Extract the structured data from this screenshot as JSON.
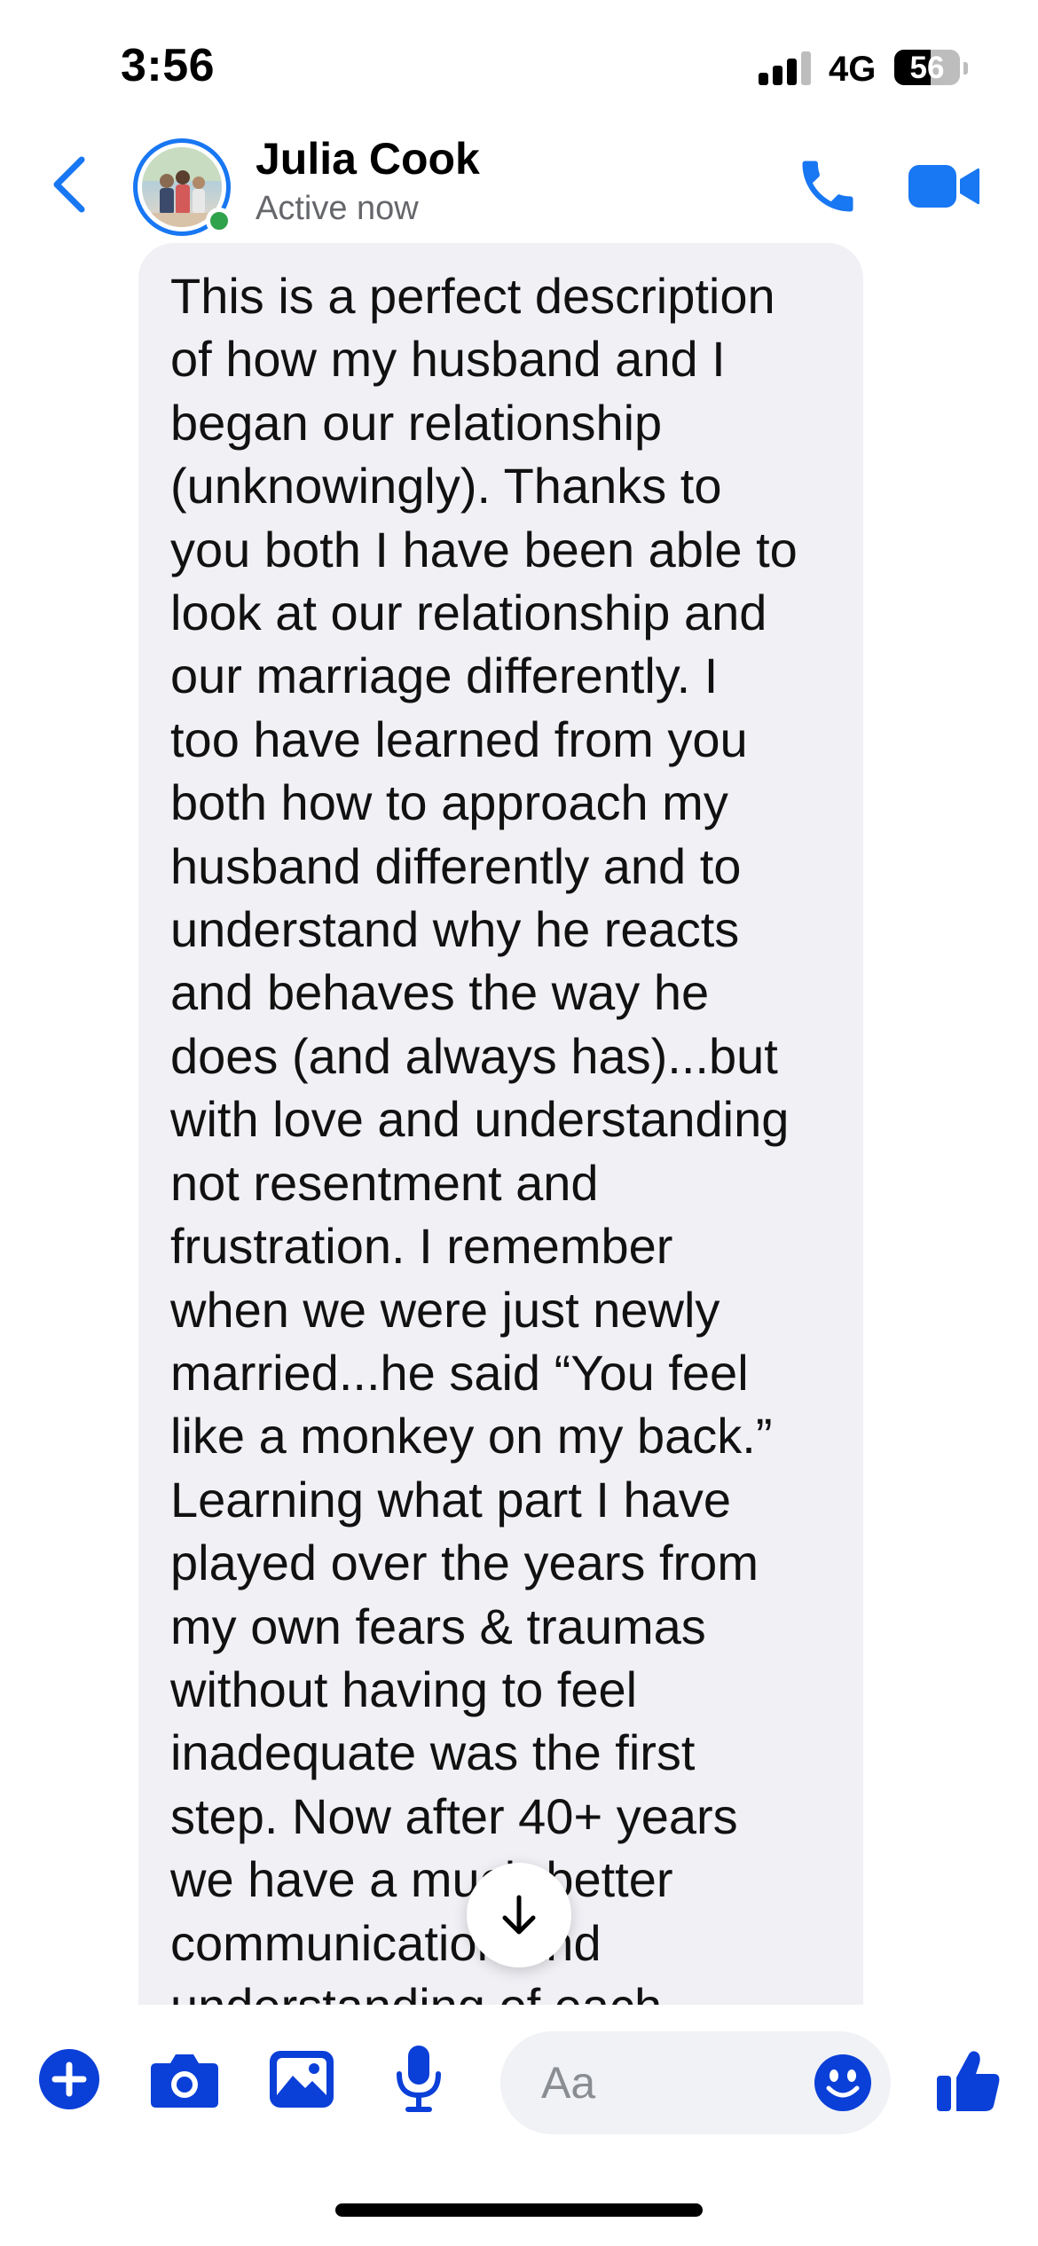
{
  "status_bar": {
    "time": "3:56",
    "network": "4G",
    "battery_level": "56",
    "signal_bars": 3
  },
  "header": {
    "contact_name": "Julia Cook",
    "contact_status": "Active now"
  },
  "message": {
    "text": "This is a perfect description\nof how my husband and I\nbegan our relationship\n(unknowingly). Thanks to\nyou both I have been able to\nlook at our relationship and\nour marriage differently. I\ntoo have learned from you\nboth how to approach my\nhusband differently and to\nunderstand why he reacts\nand behaves the way he\ndoes (and always has)...but\nwith love and understanding\nnot resentment and\nfrustration. I remember\nwhen we were just newly\nmarried...he said “You feel\nlike a monkey on my back.”\nLearning what part I have\nplayed over the years from\nmy own fears & traumas\nwithout having to feel\ninadequate was the first\nstep. Now after 40+ years\nwe have a much better\ncommunication and\nunderstanding of each"
  },
  "composer": {
    "placeholder": "Aa"
  },
  "colors": {
    "accent": "#1877f2",
    "bubble": "#f0f0f5",
    "active": "#31a24c"
  },
  "icons": {
    "back": "chevron-left-icon",
    "call": "phone-icon",
    "video": "video-camera-icon",
    "add": "plus-circle-icon",
    "camera": "camera-icon",
    "gallery": "image-icon",
    "mic": "microphone-icon",
    "emoji": "smiley-icon",
    "like": "thumbs-up-icon",
    "scroll": "arrow-down-icon"
  }
}
